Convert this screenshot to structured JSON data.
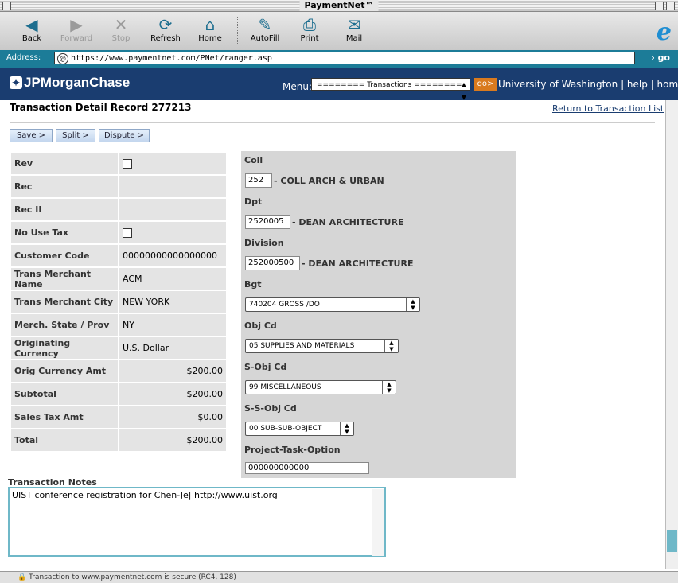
{
  "window": {
    "title": "PaymentNet™"
  },
  "toolbar": {
    "buttons": [
      {
        "label": "Back",
        "icon": "◀"
      },
      {
        "label": "Forward",
        "icon": "▶"
      },
      {
        "label": "Stop",
        "icon": "✕"
      },
      {
        "label": "Refresh",
        "icon": "⟳"
      },
      {
        "label": "Home",
        "icon": "⌂"
      },
      {
        "label": "AutoFill",
        "icon": "✎"
      },
      {
        "label": "Print",
        "icon": "⎙"
      },
      {
        "label": "Mail",
        "icon": "✉"
      }
    ],
    "browser_logo": "e"
  },
  "address": {
    "label": "Address:",
    "url": "https://www.paymentnet.com/PNet/ranger.asp",
    "go": "go"
  },
  "header": {
    "logo": "JPMorganChase",
    "menu_label": "Menu:",
    "menu_selected": "======== Transactions ========",
    "go_label": "go>",
    "org": "University of Washington",
    "help": "help",
    "home": "home"
  },
  "page": {
    "title": "Transaction Detail Record 277213",
    "return_link": "Return to Transaction List",
    "actions": [
      "Save >",
      "Split >",
      "Dispute >"
    ]
  },
  "details": [
    {
      "label": "Rev",
      "value": "",
      "type": "checkbox"
    },
    {
      "label": "Rec",
      "value": "",
      "type": "text"
    },
    {
      "label": "Rec II",
      "value": "",
      "type": "text"
    },
    {
      "label": "No Use Tax",
      "value": "",
      "type": "checkbox"
    },
    {
      "label": "Customer Code",
      "value": "00000000000000000",
      "type": "text"
    },
    {
      "label": "Trans Merchant Name",
      "value": "ACM",
      "type": "text"
    },
    {
      "label": "Trans Merchant City",
      "value": "NEW YORK",
      "type": "text"
    },
    {
      "label": "Merch. State / Prov",
      "value": "NY",
      "type": "text"
    },
    {
      "label": "Originating Currency",
      "value": "U.S. Dollar",
      "type": "text"
    },
    {
      "label": "Orig Currency Amt",
      "value": "$200.00",
      "type": "num"
    },
    {
      "label": "Subtotal",
      "value": "$200.00",
      "type": "num"
    },
    {
      "label": "Sales Tax Amt",
      "value": "$0.00",
      "type": "num"
    },
    {
      "label": "Total",
      "value": "$200.00",
      "type": "num"
    }
  ],
  "accounting": {
    "coll": {
      "label": "Coll",
      "value": "252",
      "desc": "- COLL ARCH & URBAN"
    },
    "dpt": {
      "label": "Dpt",
      "value": "2520005",
      "desc": "- DEAN ARCHITECTURE"
    },
    "division": {
      "label": "Division",
      "value": "252000500",
      "desc": "- DEAN ARCHITECTURE"
    },
    "bgt": {
      "label": "Bgt",
      "selected": "740204 GROSS /DO"
    },
    "obj": {
      "label": "Obj Cd",
      "selected": "05 SUPPLIES AND MATERIALS"
    },
    "sobj": {
      "label": "S-Obj Cd",
      "selected": "99 MISCELLANEOUS"
    },
    "ssobj": {
      "label": "S-S-Obj Cd",
      "selected": "00 SUB-SUB-OBJECT"
    },
    "pto": {
      "label": "Project-Task-Option",
      "value": "000000000000"
    }
  },
  "notes": {
    "label": "Transaction Notes",
    "value": "UIST conference registration for Chen-Je| http://www.uist.org"
  },
  "status": {
    "text": "Transaction to www.paymentnet.com is secure (RC4, 128)"
  }
}
